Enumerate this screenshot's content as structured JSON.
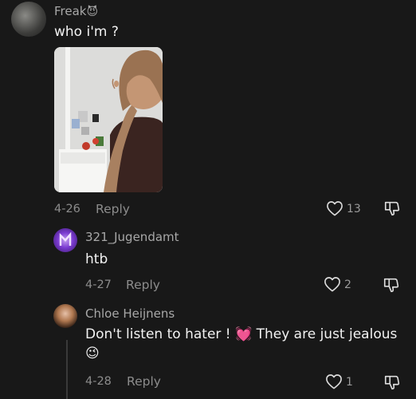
{
  "comments": [
    {
      "user": "Freak",
      "user_emoji": "😈",
      "text": "who i'm ?",
      "date": "4-26",
      "reply_label": "Reply",
      "likes": "13"
    }
  ],
  "replies": [
    {
      "user": "321_Jugendamt",
      "text": "htb",
      "date": "4-27",
      "reply_label": "Reply",
      "likes": "2"
    },
    {
      "user": "Chloe Heijnens",
      "text_part1": "Don't listen to hater !",
      "text_emoji1": "💓",
      "text_part2": "They are just jealous",
      "text_emoji2": "😉",
      "date": "4-28",
      "reply_label": "Reply",
      "likes": "1"
    }
  ],
  "icons": {
    "like": "heart-outline-icon",
    "dislike": "thumbs-down-icon"
  },
  "colors": {
    "background": "#181818",
    "username": "#a8a8a8",
    "text": "#f2f2f2",
    "meta": "#8c8c8c",
    "thread_line": "#3a3a3a"
  }
}
